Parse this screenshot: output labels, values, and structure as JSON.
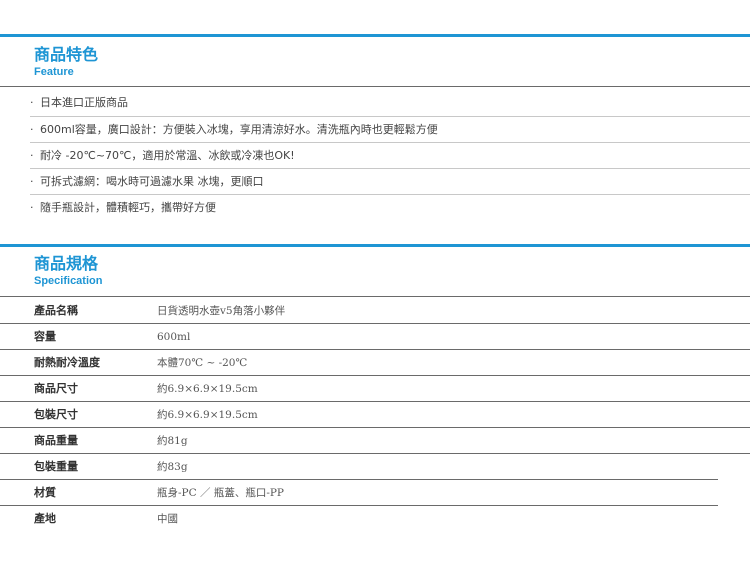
{
  "feature": {
    "title": "商品特色",
    "subtitle": "Feature",
    "bullet": "·",
    "items": [
      "日本進口正版商品",
      "600ml容量，廣口設計：方便裝入冰塊，享用清涼好水。清洗瓶內時也更輕鬆方便",
      "耐冷 -20℃~70℃，適用於常溫、冰飲或冷凍也OK!",
      "可拆式濾網：喝水時可過濾水果 冰塊，更順口",
      "隨手瓶設計，體積輕巧，攜帶好方便"
    ]
  },
  "spec": {
    "title": "商品規格",
    "subtitle": "Specification",
    "rows": [
      {
        "key": "產品名稱",
        "value": "日貨透明水壺v5角落小夥伴"
      },
      {
        "key": "容量",
        "value": "600ml"
      },
      {
        "key": "耐熱耐冷溫度",
        "value": "本體70℃ ~ -20℃"
      },
      {
        "key": "商品尺寸",
        "value": "約6.9×6.9×19.5cm"
      },
      {
        "key": "包裝尺寸",
        "value": "約6.9×6.9×19.5cm"
      },
      {
        "key": "商品重量",
        "value": "約81g"
      },
      {
        "key": "包裝重量",
        "value": "約83g"
      },
      {
        "key": "材質",
        "value": "瓶身-PC ／ 瓶蓋、瓶口-PP"
      },
      {
        "key": "產地",
        "value": "中國"
      }
    ]
  }
}
